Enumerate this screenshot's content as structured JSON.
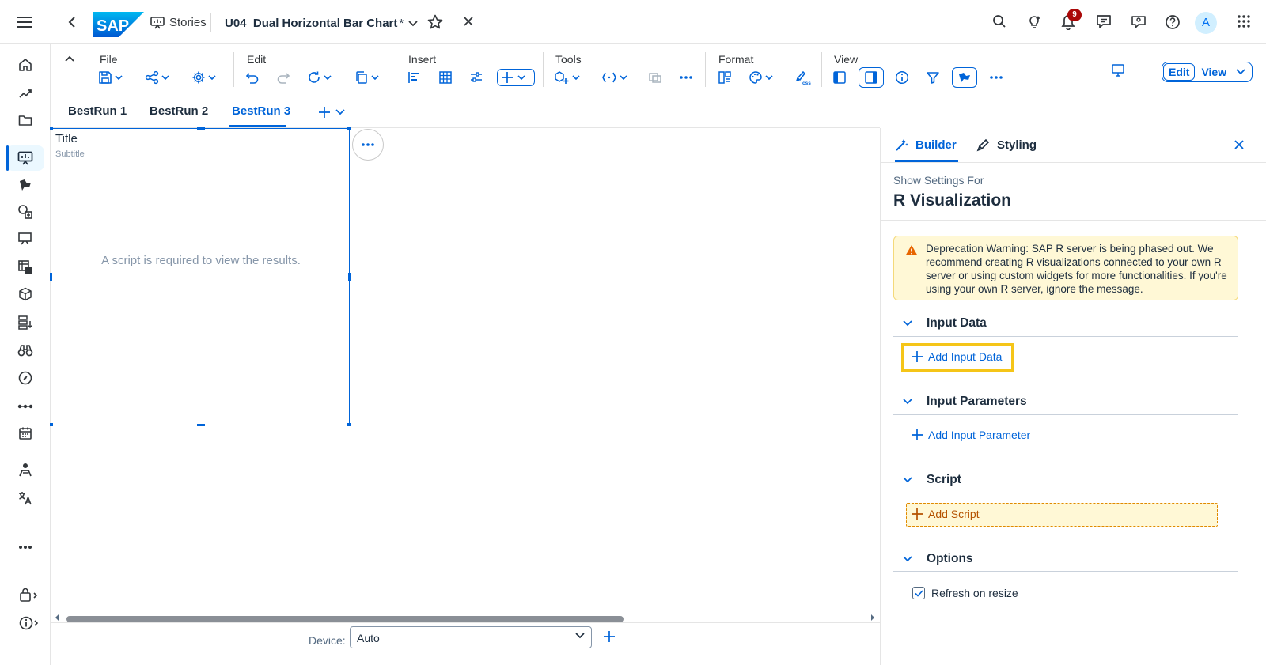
{
  "shell": {
    "logo_text": "SAP",
    "app_label": "Stories",
    "story_title": "U04_Dual Horizontal Bar Chart",
    "modified_marker": "*",
    "notification_count": "9",
    "avatar_initial": "A"
  },
  "toolbar": {
    "groups": {
      "file": "File",
      "edit": "Edit",
      "insert": "Insert",
      "tools": "Tools",
      "format": "Format",
      "view": "View"
    },
    "edit_label": "Edit",
    "view_label": "View"
  },
  "tabs": [
    {
      "label": "BestRun 1"
    },
    {
      "label": "BestRun 2"
    },
    {
      "label": "BestRun 3",
      "active": true
    }
  ],
  "widget": {
    "title": "Title",
    "subtitle": "Subtitle",
    "message": "A script is required to view the results."
  },
  "footer": {
    "device_label": "Device:",
    "device_value": "Auto"
  },
  "panel": {
    "tabs": {
      "builder": "Builder",
      "styling": "Styling"
    },
    "show_settings_for": "Show Settings For",
    "viz_name": "R Visualization",
    "warning": "Deprecation Warning: SAP R server is being phased out. We recommend creating R visualizations connected to your own R server or using custom widgets for more functionalities. If you're using your own R server, ignore the message.",
    "sections": {
      "input_data": "Input Data",
      "input_parameters": "Input Parameters",
      "script": "Script",
      "options": "Options"
    },
    "add_input_data": "Add Input Data",
    "add_input_parameter": "Add Input Parameter",
    "add_script": "Add Script",
    "refresh_on_resize": "Refresh on resize",
    "refresh_checked": true
  },
  "colors": {
    "accent": "#0064d9",
    "highlight": "#f5c518",
    "warning_bg": "#fff8d6",
    "badge": "#aa0808"
  }
}
